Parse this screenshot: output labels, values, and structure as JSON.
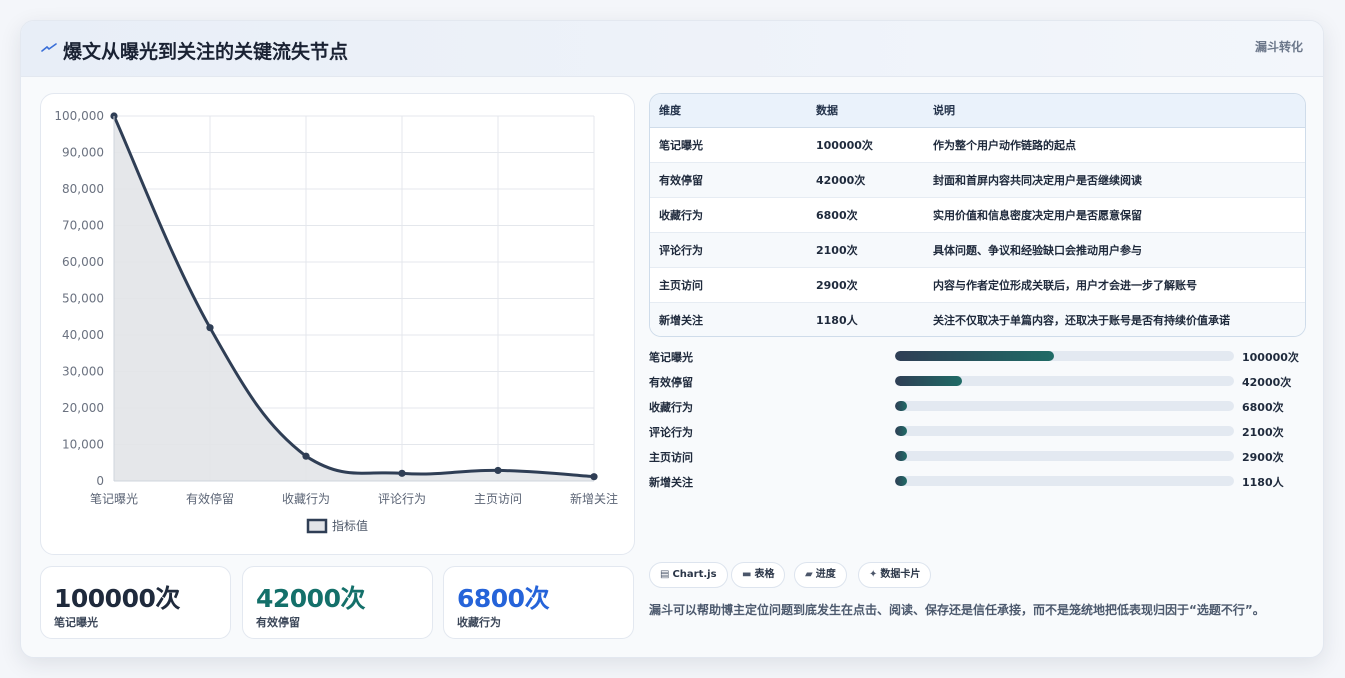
{
  "header": {
    "title": "爆文从曝光到关注的关键流失节点",
    "tag": "漏斗转化",
    "icon": "lightning-icon"
  },
  "chart_data": {
    "type": "line",
    "categories": [
      "笔记曝光",
      "有效停留",
      "收藏行为",
      "评论行为",
      "主页访问",
      "新增关注"
    ],
    "series": [
      {
        "name": "指标值",
        "values": [
          100000,
          42000,
          6800,
          2100,
          2900,
          1180
        ]
      }
    ],
    "ylim": [
      0,
      100000
    ],
    "yticks": [
      "0",
      "10,000",
      "20,000",
      "30,000",
      "40,000",
      "50,000",
      "60,000",
      "70,000",
      "80,000",
      "90,000",
      "100,000"
    ],
    "grid": true,
    "legend": "bottom",
    "area_fill": true,
    "line_color": "#2f3e55",
    "fill_color": "#e2e4e8"
  },
  "kpis": [
    {
      "value": "100000次",
      "label": "笔记曝光",
      "color": "#1f2a3c"
    },
    {
      "value": "42000次",
      "label": "有效停留",
      "color": "#14706a"
    },
    {
      "value": "6800次",
      "label": "收藏行为",
      "color": "#2563d9"
    }
  ],
  "table": {
    "headers": [
      "维度",
      "数据",
      "说明"
    ],
    "rows": [
      [
        "笔记曝光",
        "100000次",
        "作为整个用户动作链路的起点"
      ],
      [
        "有效停留",
        "42000次",
        "封面和首屏内容共同决定用户是否继续阅读"
      ],
      [
        "收藏行为",
        "6800次",
        "实用价值和信息密度决定用户是否愿意保留"
      ],
      [
        "评论行为",
        "2100次",
        "具体问题、争议和经验缺口会推动用户参与"
      ],
      [
        "主页访问",
        "2900次",
        "内容与作者定位形成关联后，用户才会进一步了解账号"
      ],
      [
        "新增关注",
        "1180人",
        "关注不仅取决于单篇内容，还取决于账号是否有持续价值承诺"
      ]
    ]
  },
  "progress": [
    {
      "label": "笔记曝光",
      "value": "100000次",
      "fraction": 0.47
    },
    {
      "label": "有效停留",
      "value": "42000次",
      "fraction": 0.197
    },
    {
      "label": "收藏行为",
      "value": "6800次",
      "fraction": 0.035
    },
    {
      "label": "评论行为",
      "value": "2100次",
      "fraction": 0.035
    },
    {
      "label": "主页访问",
      "value": "2900次",
      "fraction": 0.035
    },
    {
      "label": "新增关注",
      "value": "1180人",
      "fraction": 0.035
    }
  ],
  "chips": [
    {
      "icon": "chart-icon",
      "glyph": "▤",
      "label": "Chart.js"
    },
    {
      "icon": "table-icon",
      "glyph": "▬",
      "label": "表格"
    },
    {
      "icon": "progress-icon",
      "glyph": "▰",
      "label": "进度"
    },
    {
      "icon": "sparkle-icon",
      "glyph": "✦",
      "label": "数据卡片"
    }
  ],
  "note": "漏斗可以帮助博主定位问题到底发生在点击、阅读、保存还是信任承接，而不是笼统地把低表现归因于“选题不行”。"
}
